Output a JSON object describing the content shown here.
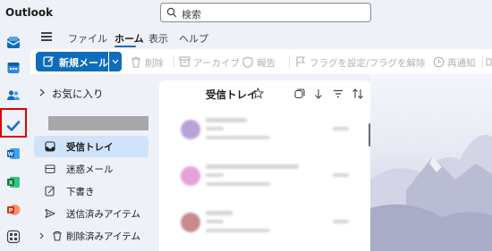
{
  "app": {
    "title": "Outlook"
  },
  "search": {
    "placeholder": "検索"
  },
  "rail": {
    "items": [
      {
        "name": "mail-icon",
        "color": "#0f6cbd"
      },
      {
        "name": "calendar-icon",
        "color": "#0f6cbd"
      },
      {
        "name": "people-icon",
        "color": "#0f6cbd"
      },
      {
        "name": "todo-icon",
        "color": "#2564cf"
      },
      {
        "name": "word-icon",
        "color": "#185abd"
      },
      {
        "name": "excel-icon",
        "color": "#107c41"
      },
      {
        "name": "powerpoint-icon",
        "color": "#c43e1c"
      },
      {
        "name": "apps-icon",
        "color": "#424242"
      }
    ],
    "highlight_color": "#e00000"
  },
  "ribbon": {
    "tabs": [
      "ファイル",
      "ホーム",
      "表示",
      "ヘルプ"
    ],
    "active_tab": "ホーム"
  },
  "toolbar": {
    "new_mail_label": "新規メール",
    "delete_label": "削除",
    "archive_label": "アーカイブ",
    "report_label": "報告",
    "flag_label": "フラグを設定/フラグを解除",
    "snooze_label": "再通知"
  },
  "folders": {
    "favorites_label": "お気に入り",
    "items": [
      {
        "label": "受信トレイ",
        "icon": "inbox-icon",
        "selected": true
      },
      {
        "label": "迷惑メール",
        "icon": "junk-icon",
        "selected": false
      },
      {
        "label": "下書き",
        "icon": "draft-icon",
        "selected": false
      },
      {
        "label": "送信済みアイテム",
        "icon": "sent-icon",
        "selected": false
      },
      {
        "label": "削除済みアイテム",
        "icon": "trash-icon",
        "selected": false
      }
    ]
  },
  "message_list": {
    "title": "受信トレイ",
    "messages": [
      {
        "avatar_color": "#b8a3d9"
      },
      {
        "avatar_color": "#e8a0d8"
      },
      {
        "avatar_color": "#c98a8e"
      }
    ]
  },
  "colors": {
    "accent": "#0f6cbd",
    "selected_folder": "#cfe4fa"
  }
}
